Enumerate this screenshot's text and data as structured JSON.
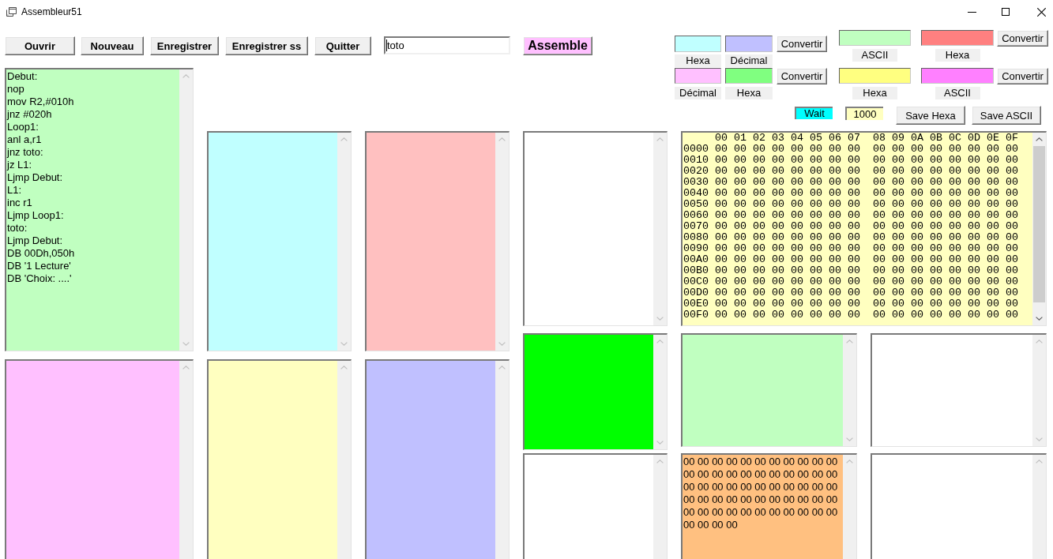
{
  "window": {
    "title": "Assembleur51"
  },
  "toolbar": {
    "buttons": [
      {
        "label": "Ouvrir"
      },
      {
        "label": "Nouveau"
      },
      {
        "label": "Enregistrer"
      },
      {
        "label": "Enregistrer ss"
      },
      {
        "label": "Quitter"
      }
    ],
    "file_name": {
      "value": "toto",
      "focused": true
    },
    "assemble_button": {
      "label": "Assemble"
    }
  },
  "converter_groups": [
    {
      "converters": [
        {
          "fields": [
            {
              "label": "Hexa",
              "color": "#c0ffff"
            },
            {
              "label": "Décimal",
              "color": "#c0c0ff"
            }
          ],
          "button": "Convertir"
        },
        {
          "fields": [
            {
              "label": "Décimal",
              "color": "#ffc0ff"
            },
            {
              "label": "Hexa",
              "color": "#80ff80"
            }
          ],
          "button": "Convertir"
        }
      ]
    },
    {
      "converters": [
        {
          "fields": [
            {
              "label": "ASCII",
              "color": "#c0ffc0"
            },
            {
              "label": "Hexa",
              "color": "#ff8080"
            }
          ],
          "button": "Convertir"
        },
        {
          "fields": [
            {
              "label": "Hexa",
              "color": "#ffff80"
            },
            {
              "label": "ASCII",
              "color": "#ff80ff"
            }
          ],
          "button": "Convertir"
        }
      ]
    }
  ],
  "wait_indicator": {
    "label": "Wait"
  },
  "delay_field": {
    "value": "1000"
  },
  "save_buttons": [
    {
      "label": "Save Hexa"
    },
    {
      "label": "Save ASCII"
    }
  ],
  "editor_columns": [
    {
      "editors": [
        {
          "color": "#c0ffc0",
          "lines": [
            "Debut:",
            "nop",
            "mov R2,#010h",
            "jnz #020h",
            "Loop1:",
            "anl a,r1",
            "jnz toto:",
            "jz L1:",
            "Ljmp Debut:",
            "L1:",
            "inc r1",
            "Ljmp Loop1:",
            "toto:",
            "Ljmp Debut:",
            "DB 00Dh,050h",
            "DB '1 Lecture'",
            "DB 'Choix: ....'"
          ]
        },
        {
          "color": "#ffc0ff"
        }
      ]
    },
    {
      "editors": [
        {
          "color": "#c0ffff"
        },
        {
          "color": "#ffffc0"
        }
      ]
    },
    {
      "editors": [
        {
          "color": "#ffc0c0"
        },
        {
          "color": "#c0c0ff"
        }
      ]
    },
    {
      "editors": [
        {
          "color": "#ffffff"
        },
        {
          "color": "#00ff00"
        },
        {
          "color": "#ffffff"
        }
      ]
    }
  ],
  "memory_dump": {
    "header": "     00 01 02 03 04 05 06 07  08 09 0A 0B 0C 0D 0E 0F",
    "lines": [
      "0000 00 00 00 00 00 00 00 00  00 00 00 00 00 00 00 00",
      "0010 00 00 00 00 00 00 00 00  00 00 00 00 00 00 00 00",
      "0020 00 00 00 00 00 00 00 00  00 00 00 00 00 00 00 00",
      "0030 00 00 00 00 00 00 00 00  00 00 00 00 00 00 00 00",
      "0040 00 00 00 00 00 00 00 00  00 00 00 00 00 00 00 00",
      "0050 00 00 00 00 00 00 00 00  00 00 00 00 00 00 00 00",
      "0060 00 00 00 00 00 00 00 00  00 00 00 00 00 00 00 00",
      "0070 00 00 00 00 00 00 00 00  00 00 00 00 00 00 00 00",
      "0080 00 00 00 00 00 00 00 00  00 00 00 00 00 00 00 00",
      "0090 00 00 00 00 00 00 00 00  00 00 00 00 00 00 00 00",
      "00A0 00 00 00 00 00 00 00 00  00 00 00 00 00 00 00 00",
      "00B0 00 00 00 00 00 00 00 00  00 00 00 00 00 00 00 00",
      "00C0 00 00 00 00 00 00 00 00  00 00 00 00 00 00 00 00",
      "00D0 00 00 00 00 00 00 00 00  00 00 00 00 00 00 00 00",
      "00E0 00 00 00 00 00 00 00 00  00 00 00 00 00 00 00 00",
      "00F0 00 00 00 00 00 00 00 00  00 00 00 00 00 00 00 00"
    ]
  },
  "output_panes": [
    {
      "color": "#c0ffc0"
    },
    {
      "color": "#ffffff"
    },
    {
      "color": "#ffc080",
      "lines": [
        "00 00 00 00 00 00 00 00 00 00 00",
        "00 00 00 00 00 00 00 00 00 00 00",
        "00 00 00 00 00 00 00 00 00 00 00",
        "00 00 00 00 00 00 00 00 00 00 00",
        "00 00 00 00 00 00 00 00 00 00 00",
        "00 00 00 00"
      ]
    },
    {
      "color": "#ffffff"
    }
  ]
}
